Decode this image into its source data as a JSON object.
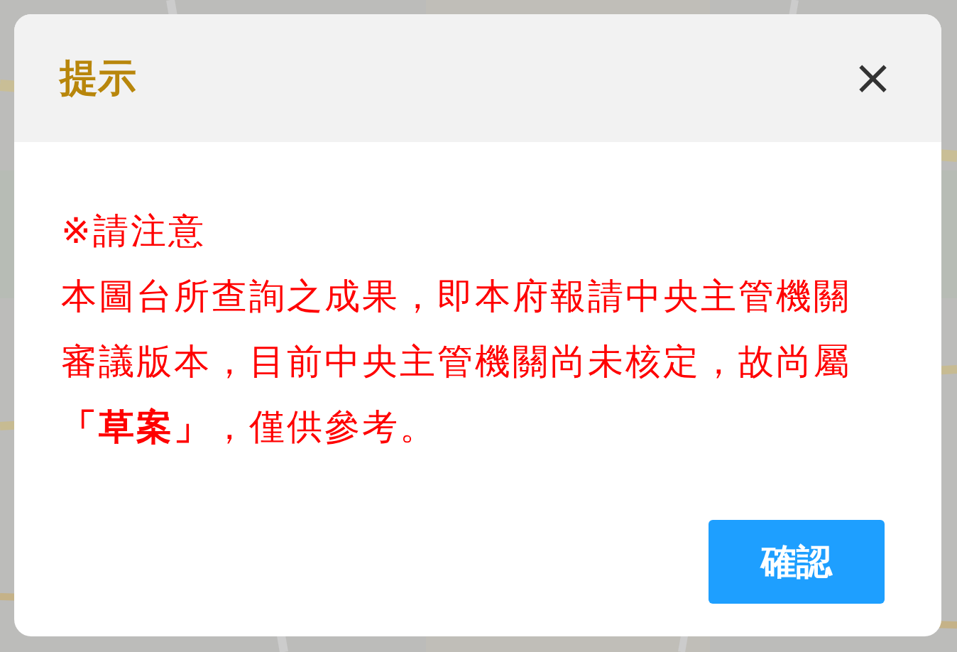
{
  "dialog": {
    "title": "提示",
    "close_label": "×",
    "notice_heading": "※請注意",
    "message_lines": [
      "本圖台所查詢之成果，即本府報請中央主管機關",
      "審議版本，目前中央主管機關尚未核定，故尚屬",
      "**「草案」**，僅供參考。"
    ],
    "buttons": [
      {
        "label": "確認"
      }
    ]
  }
}
